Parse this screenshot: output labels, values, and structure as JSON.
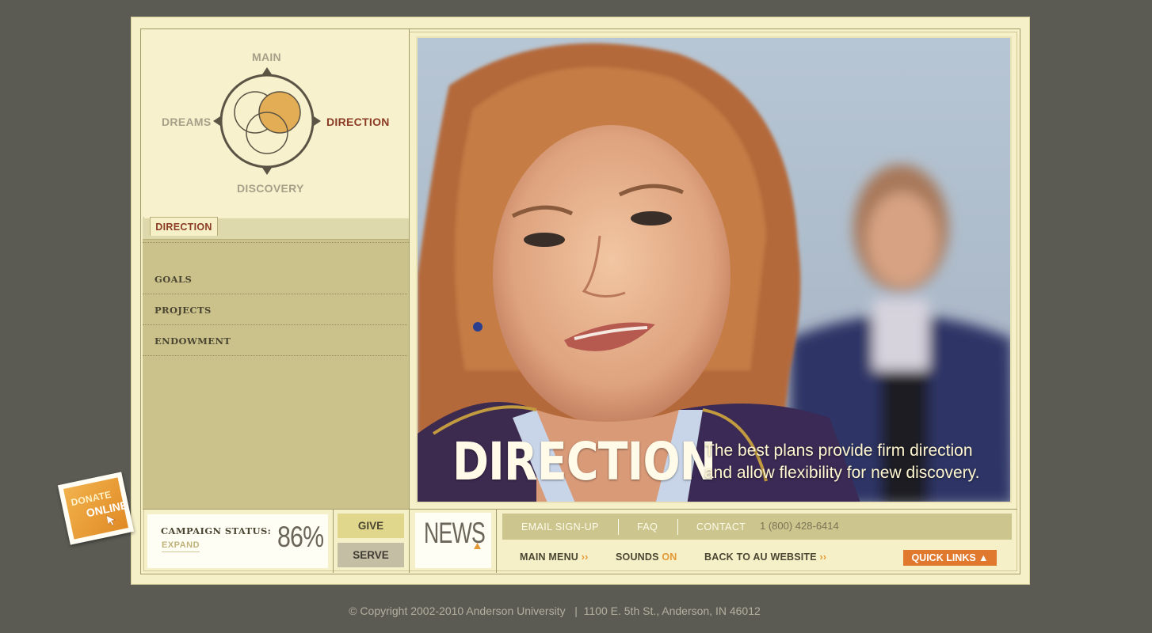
{
  "logo": {
    "top": "MAIN",
    "left": "DREAMS",
    "right": "DIRECTION",
    "bottom": "DISCOVERY"
  },
  "section_tab": "DIRECTION",
  "nav": {
    "items": [
      "GOALS",
      "PROJECTS",
      "ENDOWMENT"
    ]
  },
  "hero": {
    "title": "DIRECTION",
    "tagline_line1": "The best plans provide firm direction",
    "tagline_line2": "and allow flexibility for new discovery."
  },
  "campaign": {
    "title": "CAMPAIGN STATUS:",
    "expand": "EXPAND",
    "percent": "86%"
  },
  "buttons": {
    "give": "GIVE",
    "serve": "SERVE"
  },
  "news": {
    "label": "NEWS"
  },
  "top_links": {
    "email": "EMAIL SIGN-UP",
    "faq": "FAQ",
    "contact": "CONTACT",
    "phone": "1 (800) 428-6414"
  },
  "bottom_links": {
    "main_menu": "MAIN MENU",
    "sounds": "SOUNDS",
    "sounds_state": "ON",
    "back": "BACK TO AU WEBSITE",
    "quick_links": "QUICK LINKS",
    "chevrons": "››"
  },
  "donate": {
    "line1": "DONATE",
    "line2": "ONLINE"
  },
  "footer": {
    "copyright": "© Copyright 2002-2010 Anderson University   |  1100 E. 5th St., Anderson, IN 46012"
  },
  "colors": {
    "background": "#5b5b54",
    "panel": "#f6f0c9",
    "nav_panel": "#cbc18a",
    "accent_red": "#8b3a24",
    "accent_orange": "#e0792e",
    "give": "#e0d68c",
    "serve": "#c4bea5"
  },
  "icons": {
    "logo": "venn-compass-icon",
    "news_arrow": "triangle-up-icon",
    "quick_links_arrow": "triangle-up-icon",
    "donate_cursor": "cursor-icon"
  }
}
